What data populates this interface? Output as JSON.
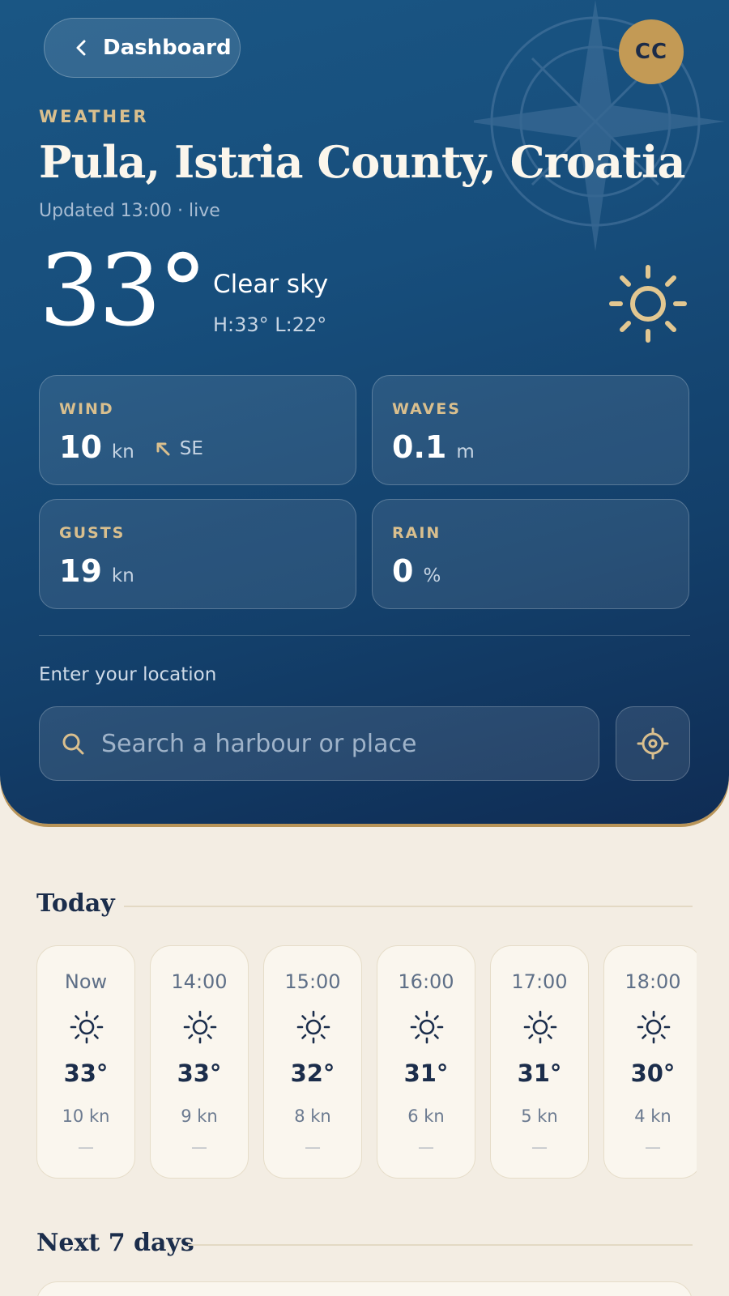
{
  "header": {
    "back_label": "Dashboard",
    "avatar_initials": "CC",
    "eyebrow": "WEATHER",
    "location": "Pula, Istria County, Croatia",
    "updated": "Updated 13:00 · live"
  },
  "current": {
    "temperature": "33°",
    "condition": "Clear sky",
    "hilo": "H:33° L:22°",
    "icon": "sun-icon"
  },
  "stats": {
    "wind": {
      "label": "WIND",
      "value": "10",
      "unit": "kn",
      "direction": "SE",
      "icon": "arrow-up-left-icon"
    },
    "waves": {
      "label": "WAVES",
      "value": "0.1",
      "unit": "m"
    },
    "gusts": {
      "label": "GUSTS",
      "value": "19",
      "unit": "kn"
    },
    "rain": {
      "label": "RAIN",
      "value": "0",
      "unit": "%"
    }
  },
  "search": {
    "label": "Enter your location",
    "placeholder": "Search a harbour or place"
  },
  "today": {
    "title": "Today",
    "hours": [
      {
        "time": "Now",
        "temp": "33°",
        "wind": "10 kn",
        "rain": "—"
      },
      {
        "time": "14:00",
        "temp": "33°",
        "wind": "9 kn",
        "rain": "—"
      },
      {
        "time": "15:00",
        "temp": "32°",
        "wind": "8 kn",
        "rain": "—"
      },
      {
        "time": "16:00",
        "temp": "31°",
        "wind": "6 kn",
        "rain": "—"
      },
      {
        "time": "17:00",
        "temp": "31°",
        "wind": "5 kn",
        "rain": "—"
      },
      {
        "time": "18:00",
        "temp": "30°",
        "wind": "4 kn",
        "rain": "—"
      }
    ]
  },
  "next_days": {
    "title": "Next 7 days"
  },
  "colors": {
    "hero_navy": "#174e7c",
    "accent_gold": "#d9bf8e",
    "avatar_gold": "#c39a55",
    "page_cream": "#f3ede3",
    "text_navy": "#1b2d4b"
  }
}
